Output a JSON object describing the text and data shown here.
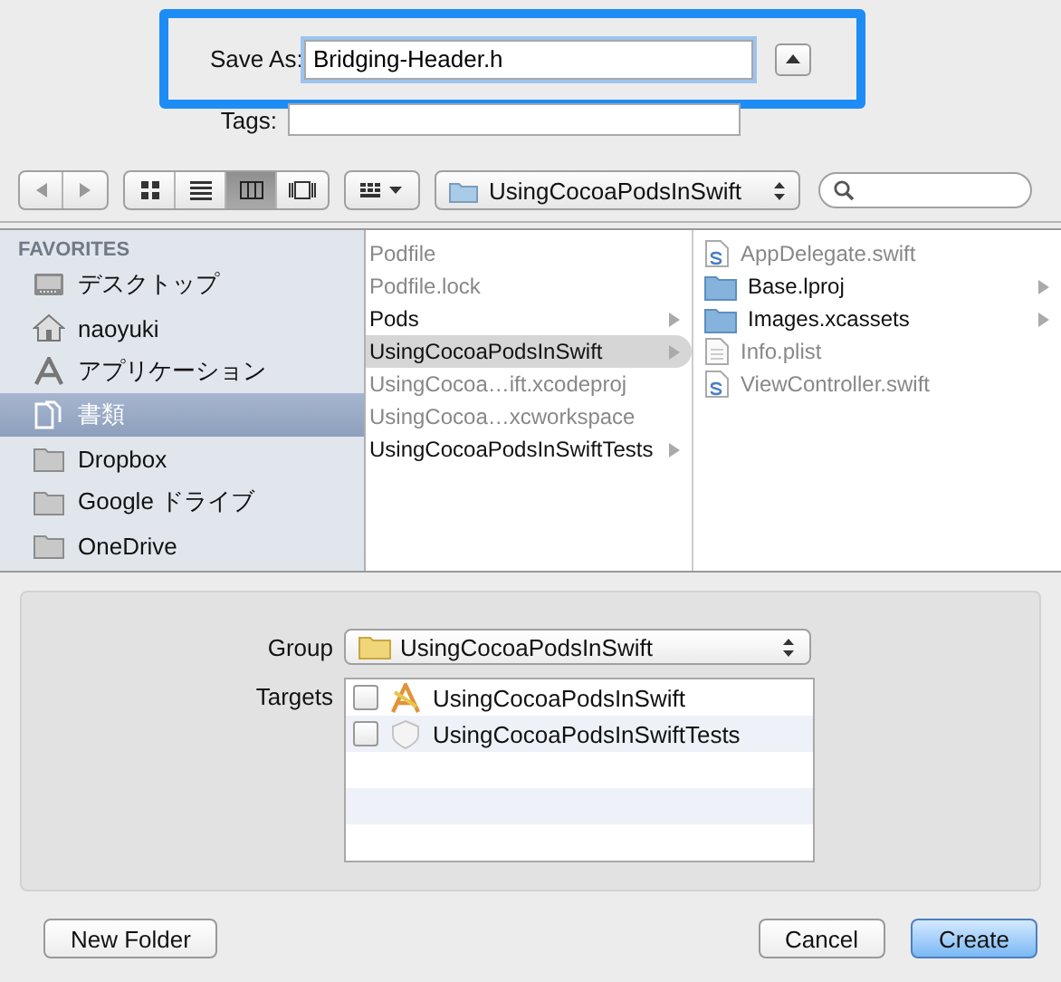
{
  "save_as": {
    "label": "Save As:",
    "value": "Bridging-Header.h",
    "highlighted": true
  },
  "tags": {
    "label": "Tags:"
  },
  "toolbar": {
    "view_modes": [
      {
        "kind": "icons",
        "selected": false
      },
      {
        "kind": "list",
        "selected": false
      },
      {
        "kind": "columns",
        "selected": true
      },
      {
        "kind": "coverflow",
        "selected": false
      }
    ],
    "location": "UsingCocoaPodsInSwift"
  },
  "sidebar": {
    "heading": "FAVORITES",
    "items": [
      {
        "label": "デスクトップ",
        "kind": "desktop",
        "selected": false
      },
      {
        "label": "naoyuki",
        "kind": "home",
        "selected": false
      },
      {
        "label": "アプリケーション",
        "kind": "apps",
        "selected": false
      },
      {
        "label": "書類",
        "kind": "documents",
        "selected": true
      },
      {
        "label": "Dropbox",
        "kind": "folder",
        "selected": false
      },
      {
        "label": "Google ドライブ",
        "kind": "folder",
        "selected": false
      },
      {
        "label": "OneDrive",
        "kind": "folder",
        "selected": false
      }
    ]
  },
  "columns": [
    {
      "items": [
        {
          "name": "Podfile",
          "disabled": true,
          "has_children": false,
          "selected": false
        },
        {
          "name": "Podfile.lock",
          "disabled": true,
          "has_children": false,
          "selected": false
        },
        {
          "name": "Pods",
          "disabled": false,
          "has_children": true,
          "selected": false
        },
        {
          "name": "UsingCocoaPodsInSwift",
          "disabled": false,
          "has_children": true,
          "selected": true
        },
        {
          "name": "UsingCocoa…ift.xcodeproj",
          "disabled": true,
          "has_children": false,
          "selected": false
        },
        {
          "name": "UsingCocoa…xcworkspace",
          "disabled": true,
          "has_children": false,
          "selected": false
        },
        {
          "name": "UsingCocoaPodsInSwiftTests",
          "disabled": false,
          "has_children": true,
          "selected": false
        }
      ]
    },
    {
      "items": [
        {
          "name": "AppDelegate.swift",
          "kind": "swift",
          "disabled": true,
          "has_children": false,
          "selected": false
        },
        {
          "name": "Base.lproj",
          "kind": "folder",
          "disabled": false,
          "has_children": true,
          "selected": false
        },
        {
          "name": "Images.xcassets",
          "kind": "folder",
          "disabled": false,
          "has_children": true,
          "selected": false
        },
        {
          "name": "Info.plist",
          "kind": "plist",
          "disabled": true,
          "has_children": false,
          "selected": false
        },
        {
          "name": "ViewController.swift",
          "kind": "swift",
          "disabled": true,
          "has_children": false,
          "selected": false
        }
      ]
    }
  ],
  "group": {
    "label": "Group",
    "value": "UsingCocoaPodsInSwift"
  },
  "targets": {
    "label": "Targets",
    "items": [
      {
        "name": "UsingCocoaPodsInSwift",
        "kind": "app",
        "checked": false
      },
      {
        "name": "UsingCocoaPodsInSwiftTests",
        "kind": "tests",
        "checked": false
      }
    ]
  },
  "buttons": [
    {
      "label": "New Folder",
      "kind": "secondary"
    },
    {
      "label": "Cancel",
      "kind": "secondary"
    },
    {
      "label": "Create",
      "kind": "default"
    }
  ]
}
